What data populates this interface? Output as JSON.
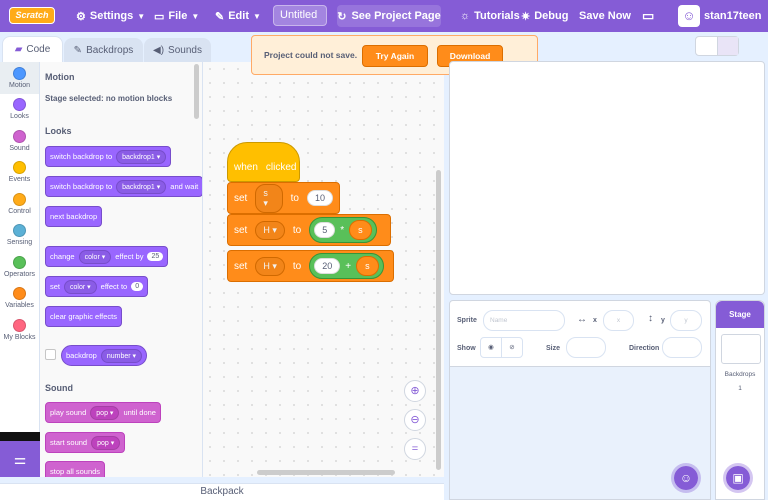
{
  "menubar": {
    "logo": "Scratch",
    "settings": "Settings",
    "file": "File",
    "edit": "Edit",
    "title_value": "Untitled",
    "see_project": "See Project Page",
    "tutorials": "Tutorials",
    "debug": "Debug",
    "save_now": "Save Now",
    "username": "stan17teen"
  },
  "tabs": {
    "code": "Code",
    "backdrops": "Backdrops",
    "sounds": "Sounds"
  },
  "categories": [
    {
      "label": "Motion",
      "color": "#4c97ff"
    },
    {
      "label": "Looks",
      "color": "#9966ff"
    },
    {
      "label": "Sound",
      "color": "#cf63cf"
    },
    {
      "label": "Events",
      "color": "#ffbf00"
    },
    {
      "label": "Control",
      "color": "#ffab19"
    },
    {
      "label": "Sensing",
      "color": "#5cb1d6"
    },
    {
      "label": "Operators",
      "color": "#59c059"
    },
    {
      "label": "Variables",
      "color": "#ff8c1a"
    },
    {
      "label": "My Blocks",
      "color": "#ff6680"
    }
  ],
  "palette": {
    "motion_heading": "Motion",
    "motion_note": "Stage selected: no motion blocks",
    "looks_heading": "Looks",
    "switch_backdrop": {
      "text": "switch backdrop to",
      "value": "backdrop1"
    },
    "switch_backdrop_wait": {
      "text": "switch backdrop to",
      "value": "backdrop1",
      "suffix": "and wait"
    },
    "next_backdrop": "next backdrop",
    "change_effect": {
      "text": "change",
      "effect": "color",
      "by": "effect by",
      "value": "25"
    },
    "set_effect": {
      "text": "set",
      "effect": "color",
      "to": "effect to",
      "value": "0"
    },
    "clear_effects": "clear graphic effects",
    "backdrop_reporter": {
      "text": "backdrop",
      "value": "number"
    },
    "sound_heading": "Sound",
    "play_sound": {
      "text": "play sound",
      "value": "pop",
      "suffix": "until done"
    },
    "start_sound": {
      "text": "start sound",
      "value": "pop"
    },
    "stop_sounds": "stop all sounds"
  },
  "script": {
    "hat": {
      "when": "when",
      "clicked": "clicked"
    },
    "block1": {
      "set": "set",
      "var": "s",
      "to": "to",
      "value": "10"
    },
    "block2": {
      "set": "set",
      "var": "H",
      "to": "to",
      "left": "5",
      "op": "*",
      "right": "s"
    },
    "block3": {
      "set": "set",
      "var": "H",
      "to": "to",
      "left": "20",
      "op": "+",
      "right": "s"
    }
  },
  "alert": {
    "message": "Project could not save.",
    "try_again": "Try Again",
    "download": "Download"
  },
  "sprite_info": {
    "sprite_label": "Sprite",
    "name_placeholder": "Name",
    "x_label": "x",
    "x_value": "x",
    "y_label": "y",
    "y_value": "y",
    "show_label": "Show",
    "size_label": "Size",
    "direction_label": "Direction"
  },
  "stage_panel": {
    "title": "Stage",
    "backdrops_label": "Backdrops",
    "backdrops_count": "1"
  },
  "backpack": "Backpack"
}
